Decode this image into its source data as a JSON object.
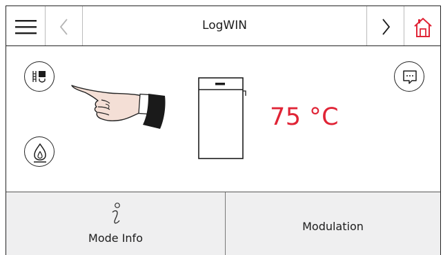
{
  "header": {
    "title": "LogWIN",
    "menu_icon": "hamburger-menu-icon",
    "back_icon": "chevron-left-icon",
    "forward_icon": "chevron-right-icon",
    "home_icon": "home-icon"
  },
  "main": {
    "temperature": "75 °C",
    "icons": [
      "heating-circuit-icon",
      "flame-icon",
      "message-icon",
      "boiler-icon",
      "pointing-hand-icon"
    ]
  },
  "bottom": {
    "tabs": [
      {
        "label": "Mode Info",
        "icon": "info-icon"
      },
      {
        "label": "Modulation"
      }
    ]
  },
  "colors": {
    "accent_red": "#e02436",
    "bottom_bg": "#efeff0",
    "disabled_gray": "#b5b5b5"
  }
}
